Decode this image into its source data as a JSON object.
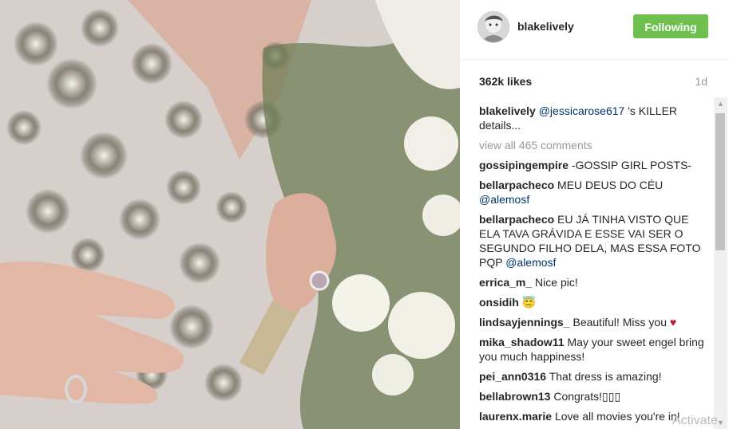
{
  "post": {
    "username": "blakelively",
    "follow_label": "Following",
    "likes": "362k likes",
    "time_ago": "1d"
  },
  "caption": {
    "user": "blakelively",
    "mention": "@jessicarose617",
    "text": " 's KILLER details..."
  },
  "view_all": "view all 465 comments",
  "comments": [
    {
      "user": "gossipingempire",
      "text": " -GOSSIP GIRL POSTS-",
      "mention": ""
    },
    {
      "user": "bellarpacheco",
      "text": " MEU DEUS DO CÉU ",
      "mention": "@alemosf"
    },
    {
      "user": "bellarpacheco",
      "text": " EU JÁ TINHA VISTO QUE ELA TAVA GRÁVIDA E ESSE VAI SER O SEGUNDO FILHO DELA, MAS ESSA FOTO PQP ",
      "mention": "@alemosf"
    },
    {
      "user": "errica_m_",
      "text": " Nice pic!",
      "mention": ""
    },
    {
      "user": "onsidih",
      "text": " 😇",
      "mention": ""
    },
    {
      "user": "lindsayjennings_",
      "text": " Beautiful! Miss you ",
      "mention": ""
    },
    {
      "user": "mika_shadow11",
      "text": " May your sweet engel bring you much happiness!",
      "mention": ""
    },
    {
      "user": "pei_ann0316",
      "text": " That dress is amazing!",
      "mention": ""
    },
    {
      "user": "bellabrown13",
      "text": " Congrats!▯▯▯",
      "mention": ""
    },
    {
      "user": "laurenx.marie",
      "text": " Love all movies you're in!",
      "mention": ""
    }
  ],
  "heart_symbol": "♥",
  "watermark": "Activate",
  "icons": {
    "scroll_up": "▲",
    "scroll_down": "▼"
  }
}
